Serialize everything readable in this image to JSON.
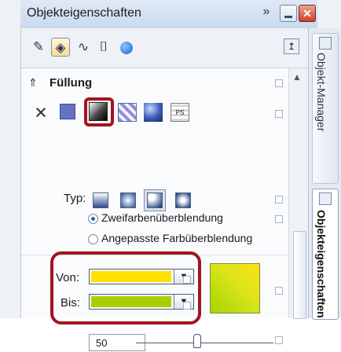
{
  "window": {
    "title": "Objekteigenschaften",
    "double_chevron": "»",
    "close": "✕"
  },
  "dockers": {
    "tab1": "Objekt-Manager",
    "tab2": "Objekteigenschaften"
  },
  "toolbar": {
    "outline_tool": "pen-icon",
    "fill_tool": "fill-icon",
    "curve_tool": "curve-icon",
    "text_tool": "text-frame-icon",
    "web_tool": "globe-icon",
    "pin_label": "↥"
  },
  "section": {
    "chevron": "⇑",
    "title": "Füllung"
  },
  "fill_types": [
    "none",
    "uniform",
    "fountain",
    "pattern",
    "texture",
    "postscript"
  ],
  "type_row": {
    "label": "Typ:"
  },
  "blend": {
    "option1": "Zweifarbenüberblendung",
    "option2": "Angepasste Farbüberblendung",
    "selected": "option1"
  },
  "colors": {
    "from_label": "Von:",
    "to_label": "Bis:",
    "from_color": "#ffe100",
    "to_color": "#a8d000",
    "highlight": "#a31420"
  },
  "midpoint": {
    "value": "50",
    "position": 0.42
  }
}
